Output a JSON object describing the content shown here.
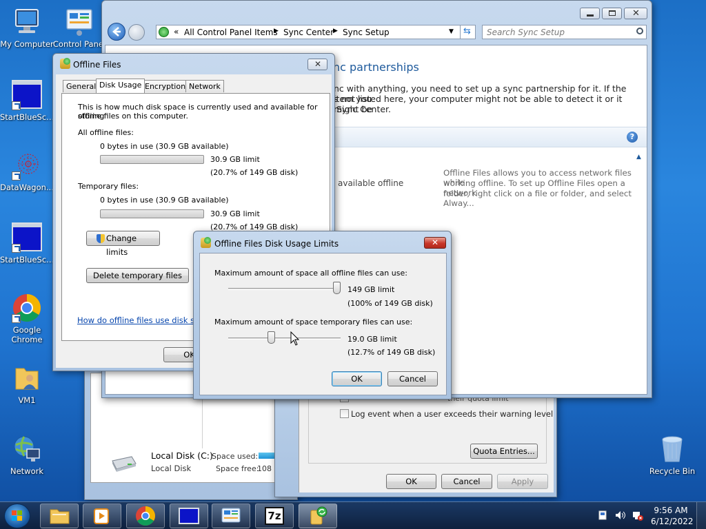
{
  "desktop": {
    "icons": [
      {
        "label": "My Computer"
      },
      {
        "label": "Control Panel"
      },
      {
        "label": "StartBlueSc..."
      },
      {
        "label": "DataWagon..."
      },
      {
        "label": "StartBlueSc..."
      },
      {
        "label": "Google Chrome"
      },
      {
        "label": "VM1"
      },
      {
        "label": "Network"
      },
      {
        "label": "Recycle Bin"
      }
    ]
  },
  "sync_window": {
    "breadcrumb": [
      "All Control Panel Items",
      "Sync Center",
      "Sync Setup"
    ],
    "breadcrumb_prefix": "«",
    "search_placeholder": "Search Sync Setup",
    "heading": "nc partnerships",
    "intro_lines": [
      "nc with anything, you need to set up a sync partnership for it. If the item you",
      "s not listed here, your computer might not be able to detect it or it might be",
      "Sync Center."
    ],
    "item_label": "available offline",
    "description_lines": [
      "Offline Files allows you to access network files while",
      "working offline. To set up Offline Files open a network",
      "folder, right click on a file or folder, and select Alway..."
    ]
  },
  "quota_window": {
    "partial_text": "their quota limit",
    "log_warning": "Log event when a user exceeds their warning level",
    "quota_entries": "Quota Entries...",
    "ok": "OK",
    "cancel": "Cancel",
    "apply": "Apply"
  },
  "disk_window": {
    "name": "Local Disk (C:)",
    "type": "Local Disk",
    "space_used_label": "Space used:",
    "space_free_label": "Space free:",
    "space_free_value": "108 G"
  },
  "offline_files": {
    "title": "Offline Files",
    "tabs": [
      "General",
      "Disk Usage",
      "Encryption",
      "Network"
    ],
    "intro_lines": [
      "This is how much disk space is currently used and available for storing",
      "offline files on this computer."
    ],
    "all_label": "All offline files:",
    "all_usage": "0 bytes in use (30.9 GB available)",
    "all_limit": "30.9 GB limit",
    "all_pct": "(20.7% of 149 GB disk)",
    "temp_label": "Temporary files:",
    "temp_usage": "0 bytes in use (30.9 GB available)",
    "temp_limit": "30.9 GB limit",
    "temp_pct": "(20.7% of 149 GB disk)",
    "change_limits": "Change limits",
    "delete_temp": "Delete temporary files",
    "help_link": "How do offline files use disk space?",
    "ok_partial": "OK"
  },
  "limits_dialog": {
    "title": "Offline Files Disk Usage Limits",
    "max_all_label": "Maximum amount of space all offline files can use:",
    "max_all_limit": "149 GB limit",
    "max_all_pct": "(100% of 149 GB disk)",
    "max_all_fraction": 1.0,
    "max_temp_label": "Maximum amount of space temporary files can use:",
    "max_temp_limit": "19.0 GB limit",
    "max_temp_pct": "(12.7% of 149 GB disk)",
    "max_temp_fraction": 0.127,
    "ok": "OK",
    "cancel": "Cancel"
  },
  "taskbar": {
    "time": "9:56 AM",
    "date": "6/12/2022"
  },
  "colors": {
    "heading_blue": "#1e5a9c",
    "link_blue": "#0645ad",
    "close_red": "#c8372a"
  }
}
